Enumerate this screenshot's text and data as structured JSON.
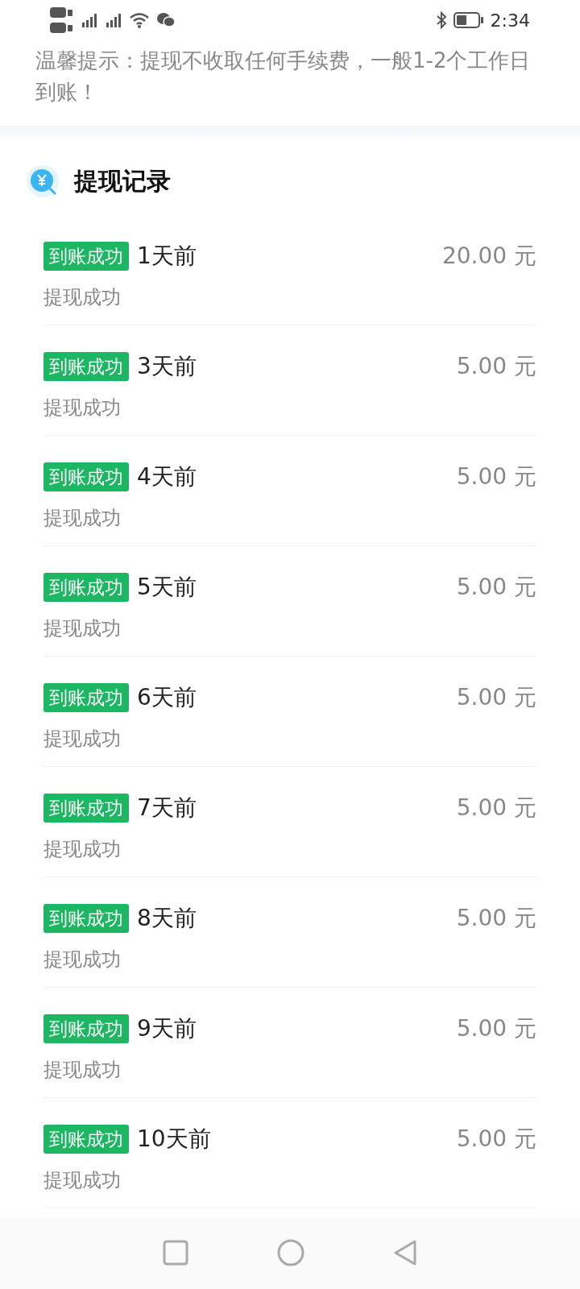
{
  "status_bar": {
    "time": "2:34"
  },
  "notice": "温馨提示：提现不收取任何手续费，一般1-2个工作日到账！",
  "section": {
    "title": "提现记录"
  },
  "records": [
    {
      "status": "到账成功",
      "time": "1天前",
      "amount": "20.00 元",
      "note": "提现成功"
    },
    {
      "status": "到账成功",
      "time": "3天前",
      "amount": "5.00 元",
      "note": "提现成功"
    },
    {
      "status": "到账成功",
      "time": "4天前",
      "amount": "5.00 元",
      "note": "提现成功"
    },
    {
      "status": "到账成功",
      "time": "5天前",
      "amount": "5.00 元",
      "note": "提现成功"
    },
    {
      "status": "到账成功",
      "time": "6天前",
      "amount": "5.00 元",
      "note": "提现成功"
    },
    {
      "status": "到账成功",
      "time": "7天前",
      "amount": "5.00 元",
      "note": "提现成功"
    },
    {
      "status": "到账成功",
      "time": "8天前",
      "amount": "5.00 元",
      "note": "提现成功"
    },
    {
      "status": "到账成功",
      "time": "9天前",
      "amount": "5.00 元",
      "note": "提现成功"
    },
    {
      "status": "到账成功",
      "time": "10天前",
      "amount": "5.00 元",
      "note": "提现成功"
    }
  ]
}
